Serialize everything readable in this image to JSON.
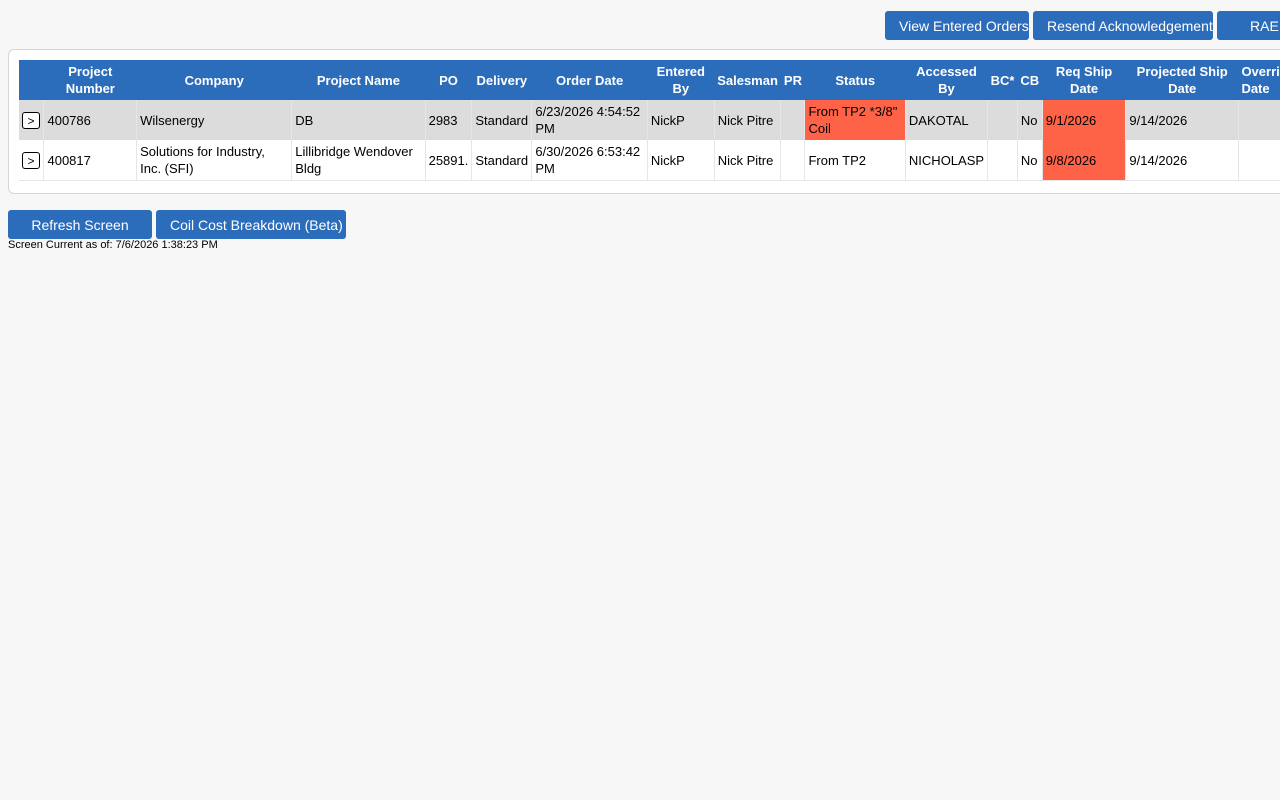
{
  "toolbar": {
    "view_entered_orders": "View Entered Orders",
    "resend_acknowledgement": "Resend Acknowledgement",
    "rae": "RAE"
  },
  "table": {
    "headers": {
      "expand": "",
      "project_number": "Project Number",
      "company": "Company",
      "project_name": "Project Name",
      "po": "PO",
      "delivery": "Delivery",
      "order_date": "Order Date",
      "entered_by": "Entered By",
      "salesman": "Salesman",
      "pr": "PR",
      "status": "Status",
      "accessed_by": "Accessed By",
      "bc": "BC*",
      "cb": "CB",
      "req_ship_date": "Req Ship Date",
      "projected_ship_date": "Projected Ship Date",
      "override": "Override Date"
    },
    "rows": [
      {
        "expand": ">",
        "project_number": "400786",
        "company": "Wilsenergy",
        "project_name": "DB",
        "po": "2983",
        "delivery": "Standard",
        "order_date": "6/23/2026 4:54:52 PM",
        "entered_by": "NickP",
        "salesman": "Nick Pitre",
        "pr": "",
        "status": "From TP2 *3/8\" Coil",
        "accessed_by": "DAKOTAL",
        "bc": "",
        "cb": "No",
        "req_ship_date": "9/1/2026",
        "projected_ship_date": "9/14/2026",
        "override": ""
      },
      {
        "expand": ">",
        "project_number": "400817",
        "company": "Solutions for Industry, Inc. (SFI)",
        "project_name": "Lillibridge Wendover Bldg",
        "po": "25891.",
        "delivery": "Standard",
        "order_date": "6/30/2026 6:53:42 PM",
        "entered_by": "NickP",
        "salesman": "Nick Pitre",
        "pr": "",
        "status": "From TP2",
        "accessed_by": "NICHOLASP",
        "bc": "",
        "cb": "No",
        "req_ship_date": "9/8/2026",
        "projected_ship_date": "9/14/2026",
        "override": ""
      }
    ]
  },
  "footer": {
    "refresh_screen": "Refresh Screen",
    "coil_cost_breakdown": "Coil Cost Breakdown (Beta)",
    "screen_current": "Screen Current as of: 7/6/2026 1:38:23 PM"
  },
  "colors": {
    "primary_button": "#2c6dbb",
    "table_header": "#2c6dbb",
    "highlight": "#ff6347",
    "row_alt": "#dcdcdc"
  }
}
